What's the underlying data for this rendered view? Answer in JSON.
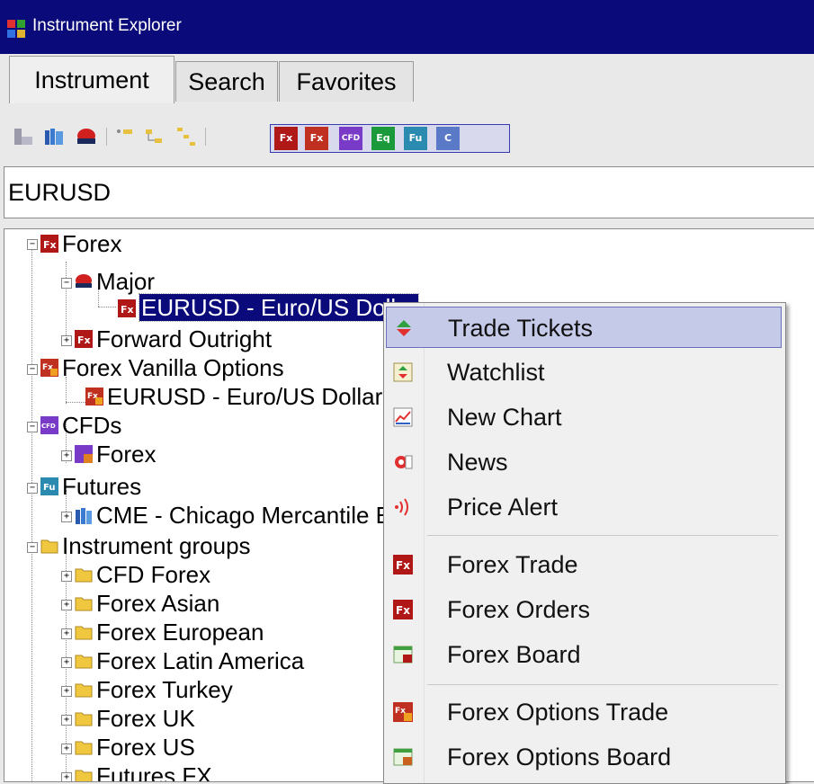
{
  "window": {
    "title": "Instrument Explorer"
  },
  "tabs": [
    {
      "label": "Instrument",
      "active": true
    },
    {
      "label": "Search",
      "active": false
    },
    {
      "label": "Favorites",
      "active": false
    }
  ],
  "toolbar": {
    "asset_buttons": [
      "Fx",
      "Fx",
      "CFD",
      "Eq",
      "Fu",
      "C"
    ]
  },
  "search": {
    "value": "EURUSD"
  },
  "tree": {
    "forex": "Forex",
    "major": "Major",
    "eurusd_selected": "EURUSD - Euro/US Dollar",
    "forward_outright": "Forward Outright",
    "forex_vanilla": "Forex Vanilla Options",
    "eurusd_option": "EURUSD - Euro/US Dollar",
    "cfds": "CFDs",
    "cfd_forex": "Forex",
    "futures": "Futures",
    "cme": "CME - Chicago Mercantile Exchange",
    "instrument_groups": "Instrument groups",
    "groups": [
      "CFD Forex",
      "Forex Asian",
      "Forex European",
      "Forex Latin America",
      "Forex Turkey",
      "Forex UK",
      "Forex US",
      "Futures FX"
    ]
  },
  "context_menu": {
    "items": [
      {
        "label": "Trade Tickets",
        "icon": "trade-tickets-icon",
        "highlighted": true
      },
      {
        "label": "Watchlist",
        "icon": "watchlist-icon"
      },
      {
        "label": "New Chart",
        "icon": "chart-icon"
      },
      {
        "label": "News",
        "icon": "news-icon"
      },
      {
        "label": "Price Alert",
        "icon": "price-alert-icon"
      },
      {
        "label": "Forex Trade",
        "icon": "forex-icon"
      },
      {
        "label": "Forex Orders",
        "icon": "forex-icon"
      },
      {
        "label": "Forex Board",
        "icon": "board-icon"
      },
      {
        "label": "Forex Options Trade",
        "icon": "forex-options-icon"
      },
      {
        "label": "Forex Options Board",
        "icon": "options-board-icon"
      }
    ]
  },
  "colors": {
    "titlebar": "#0a0a7a",
    "selection": "#0a0a7a",
    "menu_highlight": "#c5cae8",
    "forex_red": "#b01818",
    "cfd_purple": "#7a3ac8",
    "equity_green": "#1a9a3a",
    "futures_teal": "#2a8ab0"
  }
}
